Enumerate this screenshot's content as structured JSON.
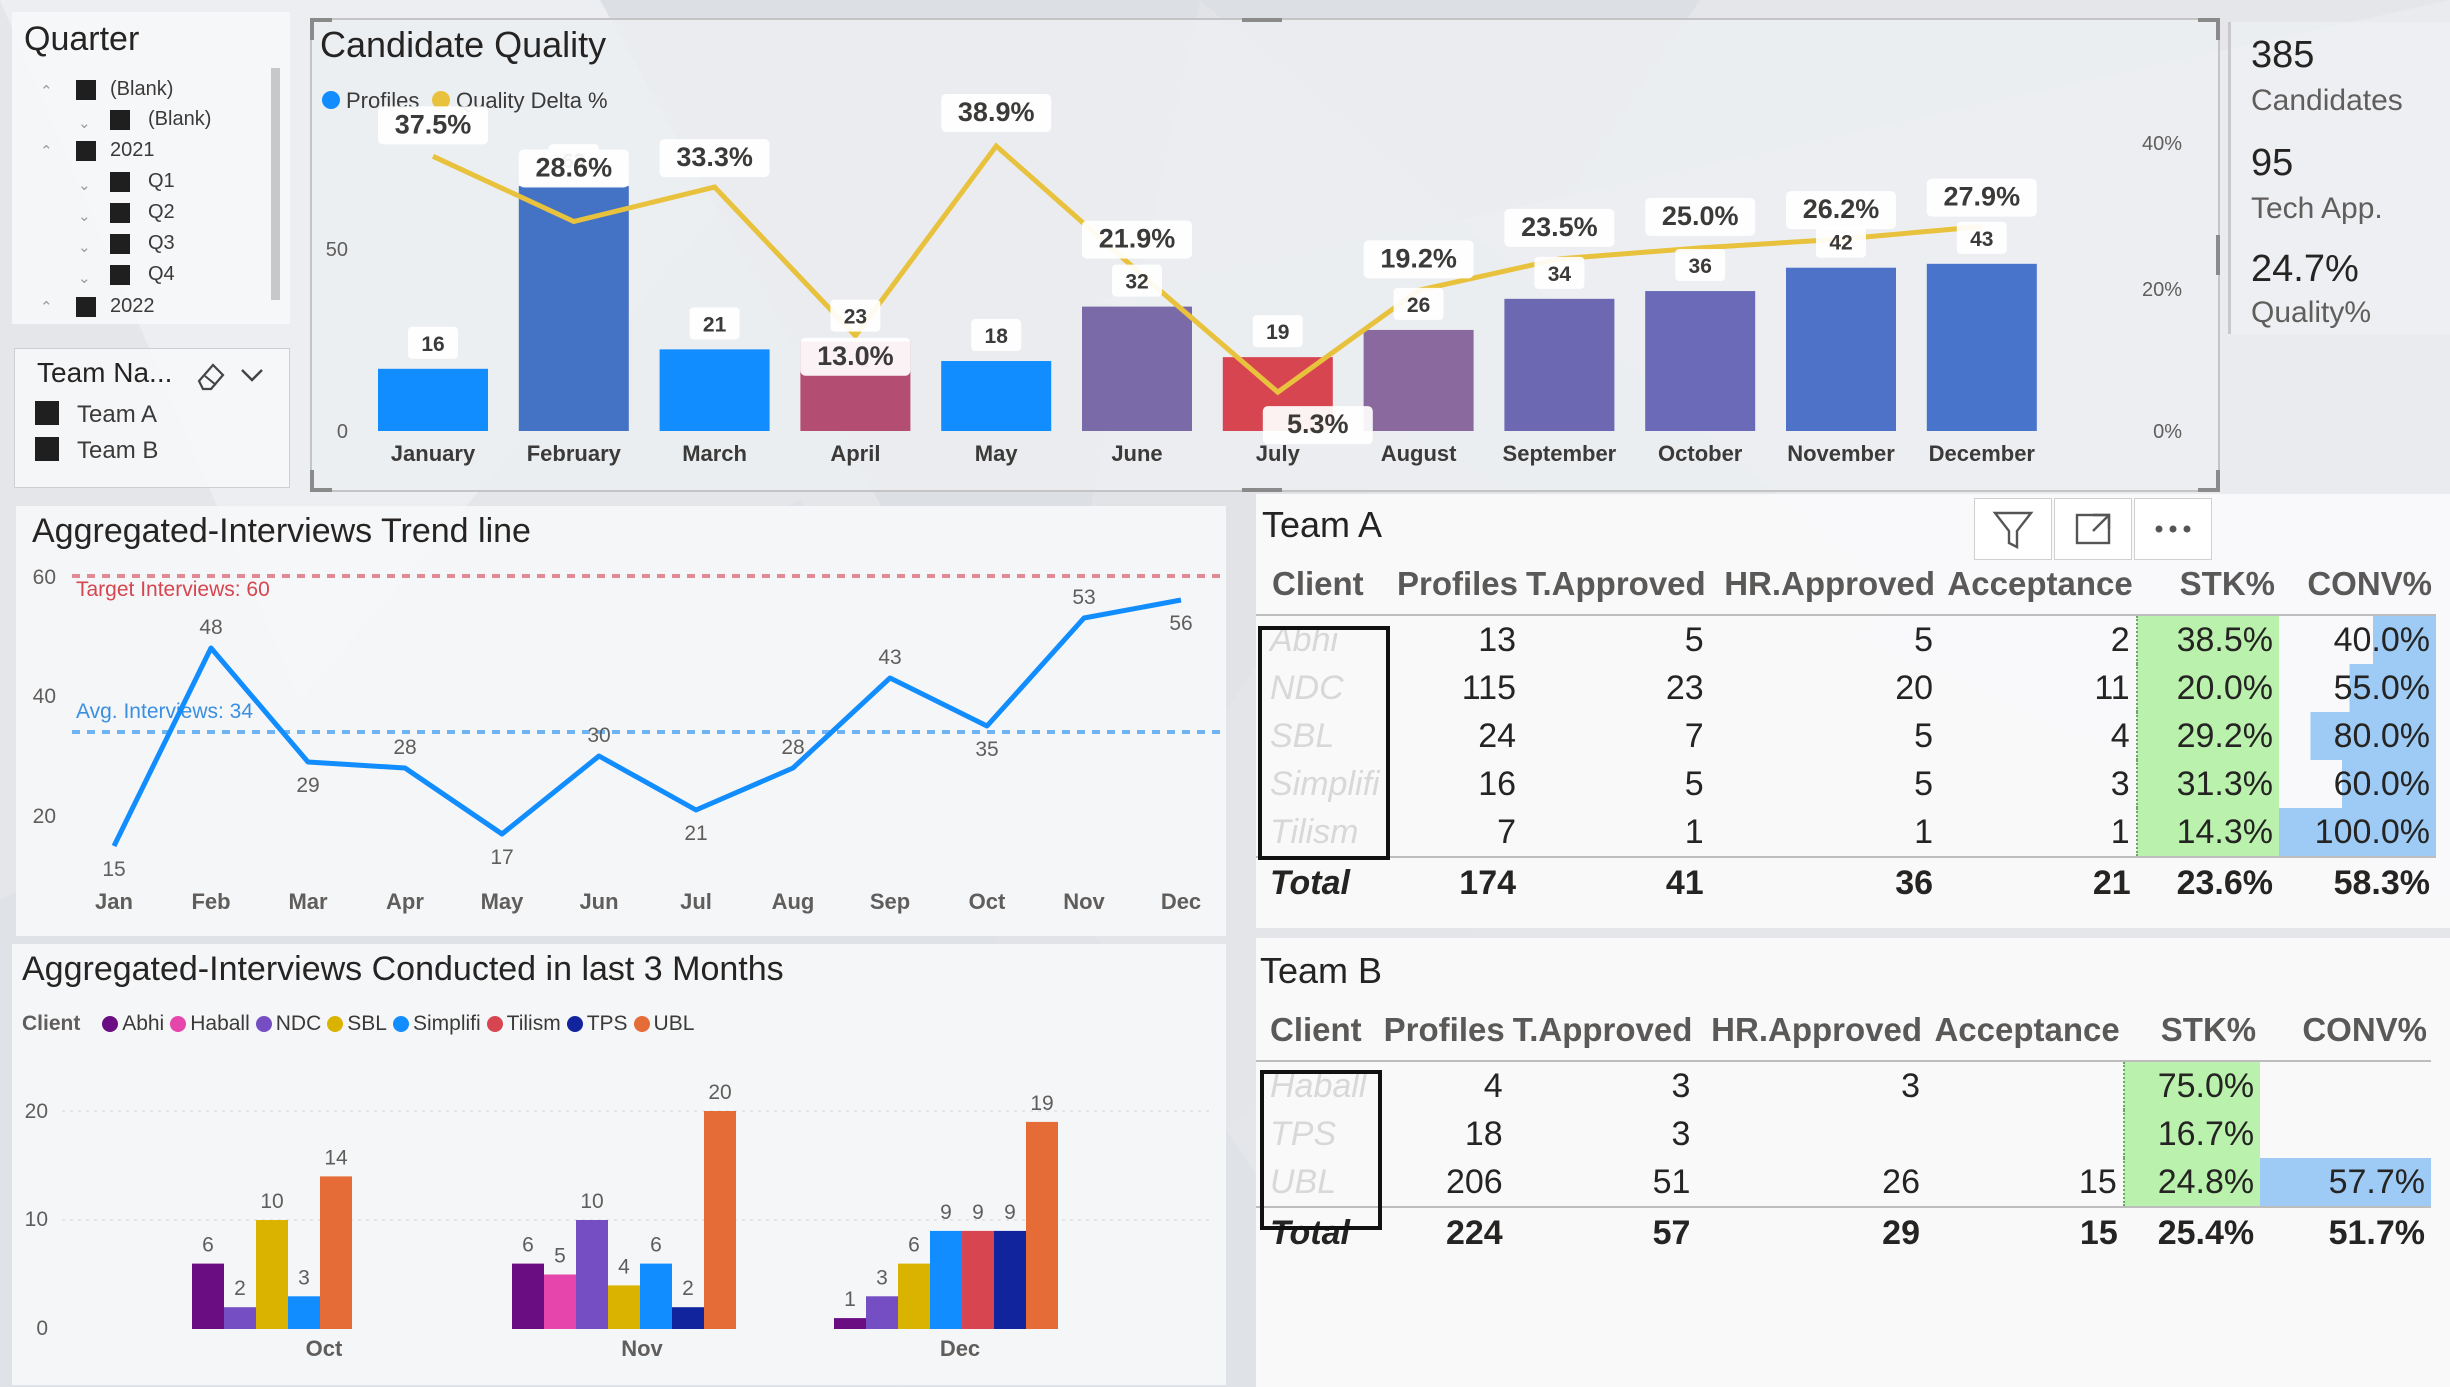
{
  "quarter_slicer": {
    "title": "Quarter",
    "items": [
      "(Blank)",
      "(Blank)",
      "2021",
      "Q1",
      "Q2",
      "Q3",
      "Q4",
      "2022"
    ]
  },
  "team_slicer": {
    "title": "Team Na...",
    "items": [
      "Team A",
      "Team B"
    ]
  },
  "kpis": [
    {
      "value": "385",
      "label": "Candidates"
    },
    {
      "value": "95",
      "label": "Tech App."
    },
    {
      "value": "24.7%",
      "label": "Quality%"
    }
  ],
  "candidate_quality": {
    "title": "Candidate Quality",
    "legend": [
      "Profiles",
      "Quality Delta %"
    ],
    "left_ticks": [
      "0",
      "50"
    ],
    "right_ticks": [
      "0%",
      "20%",
      "40%"
    ]
  },
  "trend": {
    "title": "Aggregated-Interviews Trend line",
    "target_label": "Target Interviews: 60",
    "avg_label": "Avg. Interviews: 34",
    "y_ticks": [
      "20",
      "40",
      "60"
    ]
  },
  "conducted": {
    "title": "Aggregated-Interviews Conducted in last 3 Months",
    "legend_title": "Client",
    "y_ticks": [
      "0",
      "10",
      "20"
    ]
  },
  "chart_data": [
    {
      "type": "bar",
      "title": "Candidate Quality",
      "categories": [
        "January",
        "February",
        "March",
        "April",
        "May",
        "June",
        "July",
        "August",
        "September",
        "October",
        "November",
        "December"
      ],
      "series": [
        {
          "name": "Profiles",
          "values": [
            16,
            63,
            21,
            23,
            18,
            32,
            19,
            26,
            34,
            36,
            42,
            43
          ]
        },
        {
          "name": "Quality Delta %",
          "values": [
            37.5,
            28.6,
            33.3,
            13.0,
            38.9,
            21.9,
            5.3,
            19.2,
            23.5,
            25.0,
            26.2,
            27.9
          ]
        }
      ],
      "ylim": [
        0,
        80
      ],
      "y2lim": [
        0,
        45
      ],
      "colors": [
        "#118dff",
        "#4472c4",
        "#118dff",
        "#b34d72",
        "#118dff",
        "#7b6aa8",
        "#d64550",
        "#8a6a9e",
        "#6c68b2",
        "#6a6ab8",
        "#4f72c9",
        "#4874cc"
      ],
      "line_color": "#e8c23c"
    },
    {
      "type": "line",
      "title": "Aggregated-Interviews Trend line",
      "categories": [
        "Jan",
        "Feb",
        "Mar",
        "Apr",
        "May",
        "Jun",
        "Jul",
        "Aug",
        "Sep",
        "Oct",
        "Nov",
        "Dec"
      ],
      "values": [
        15,
        48,
        29,
        28,
        17,
        30,
        21,
        28,
        43,
        35,
        53,
        56
      ],
      "ylim": [
        10,
        62
      ],
      "target": 60,
      "average": 34
    },
    {
      "type": "bar",
      "title": "Aggregated-Interviews Conducted in last 3 Months",
      "categories": [
        "Oct",
        "Nov",
        "Dec"
      ],
      "series": [
        {
          "name": "Abhi",
          "color": "#6a0d83",
          "values": [
            6,
            6,
            1
          ]
        },
        {
          "name": "Haball",
          "color": "#e645ab",
          "values": [
            null,
            5,
            null
          ]
        },
        {
          "name": "NDC",
          "color": "#744ec2",
          "values": [
            2,
            10,
            3
          ]
        },
        {
          "name": "SBL",
          "color": "#d9b300",
          "values": [
            10,
            4,
            6
          ]
        },
        {
          "name": "Simplifi",
          "color": "#118dff",
          "values": [
            3,
            6,
            9
          ]
        },
        {
          "name": "Tilism",
          "color": "#d64550",
          "values": [
            null,
            null,
            9
          ]
        },
        {
          "name": "TPS",
          "color": "#12239e",
          "values": [
            null,
            2,
            9
          ]
        },
        {
          "name": "UBL",
          "color": "#e66c37",
          "values": [
            14,
            20,
            19
          ]
        }
      ],
      "ylim": [
        0,
        22
      ]
    }
  ],
  "team_a": {
    "title": "Team A",
    "headers": [
      "Client",
      "Profiles",
      "T.Approved",
      "HR.Approved",
      "Acceptance",
      "STK%",
      "CONV%"
    ],
    "rows": [
      [
        "Abhi",
        "13",
        "5",
        "5",
        "2",
        "38.5%",
        "40.0%"
      ],
      [
        "NDC",
        "115",
        "23",
        "20",
        "11",
        "20.0%",
        "55.0%"
      ],
      [
        "SBL",
        "24",
        "7",
        "5",
        "4",
        "29.2%",
        "80.0%"
      ],
      [
        "Simplifi",
        "16",
        "5",
        "5",
        "3",
        "31.3%",
        "60.0%"
      ],
      [
        "Tilism",
        "7",
        "1",
        "1",
        "1",
        "14.3%",
        "100.0%"
      ]
    ],
    "total": [
      "Total",
      "174",
      "41",
      "36",
      "21",
      "23.6%",
      "58.3%"
    ],
    "conv_fill": [
      0.4,
      0.55,
      0.8,
      0.6,
      1.0
    ]
  },
  "team_b": {
    "title": "Team B",
    "headers": [
      "Client",
      "Profiles",
      "T.Approved",
      "HR.Approved",
      "Acceptance",
      "STK%",
      "CONV%"
    ],
    "rows": [
      [
        "Haball",
        "4",
        "3",
        "3",
        "",
        "75.0%",
        ""
      ],
      [
        "TPS",
        "18",
        "3",
        "",
        "",
        "16.7%",
        ""
      ],
      [
        "UBL",
        "206",
        "51",
        "26",
        "15",
        "24.8%",
        "57.7%"
      ]
    ],
    "total": [
      "Total",
      "224",
      "57",
      "29",
      "15",
      "25.4%",
      "51.7%"
    ],
    "conv_fill": [
      0,
      0,
      1.0
    ]
  }
}
